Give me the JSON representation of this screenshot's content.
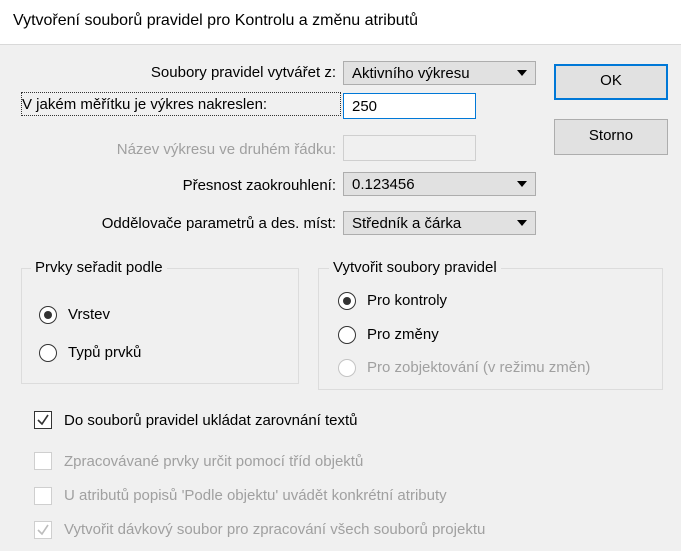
{
  "dialog": {
    "title": "Vytvoření souborů pravidel pro Kontrolu a změnu atributů"
  },
  "fields": {
    "source_label_pre": "Soubory pravidel vytvářet z:",
    "source_value": "Aktivního výkresu",
    "scale_label": "V jakém měřítku je výkres nakreslen:",
    "scale_value": "250",
    "drawing_name_label": "Název výkresu ve druhém řádku:",
    "drawing_name_value": "",
    "precision_label": "Přesnost zaokrouhlení:",
    "precision_value": "0.123456",
    "separators_label": "Oddělovače parametrů a des. míst:",
    "separators_value": "Středník a čárka"
  },
  "buttons": {
    "ok": "OK",
    "cancel": "Storno"
  },
  "sort_group": {
    "title": "Prvky seřadit podle",
    "options": [
      {
        "label": "Vrstev",
        "checked": true,
        "enabled": true
      },
      {
        "label": "Typů prvků",
        "checked": false,
        "enabled": true
      }
    ]
  },
  "create_group": {
    "title": "Vytvořit soubory pravidel",
    "options": [
      {
        "label": "Pro kontroly",
        "checked": true,
        "enabled": true
      },
      {
        "label": "Pro změny",
        "checked": false,
        "enabled": true
      },
      {
        "label": "Pro zobjektování (v režimu změn)",
        "checked": false,
        "enabled": false
      }
    ]
  },
  "checkboxes": [
    {
      "label": "Do souborů pravidel ukládat zarovnání textů",
      "checked": true,
      "enabled": true
    },
    {
      "label": "Zpracovávané prvky určit pomocí tříd objektů",
      "checked": false,
      "enabled": false
    },
    {
      "label": "U atributů popisů 'Podle objektu' uvádět konkrétní atributy",
      "checked": false,
      "enabled": false
    },
    {
      "label": "Vytvořit dávkový soubor pro zpracování všech souborů projektu",
      "checked": true,
      "enabled": false
    }
  ]
}
